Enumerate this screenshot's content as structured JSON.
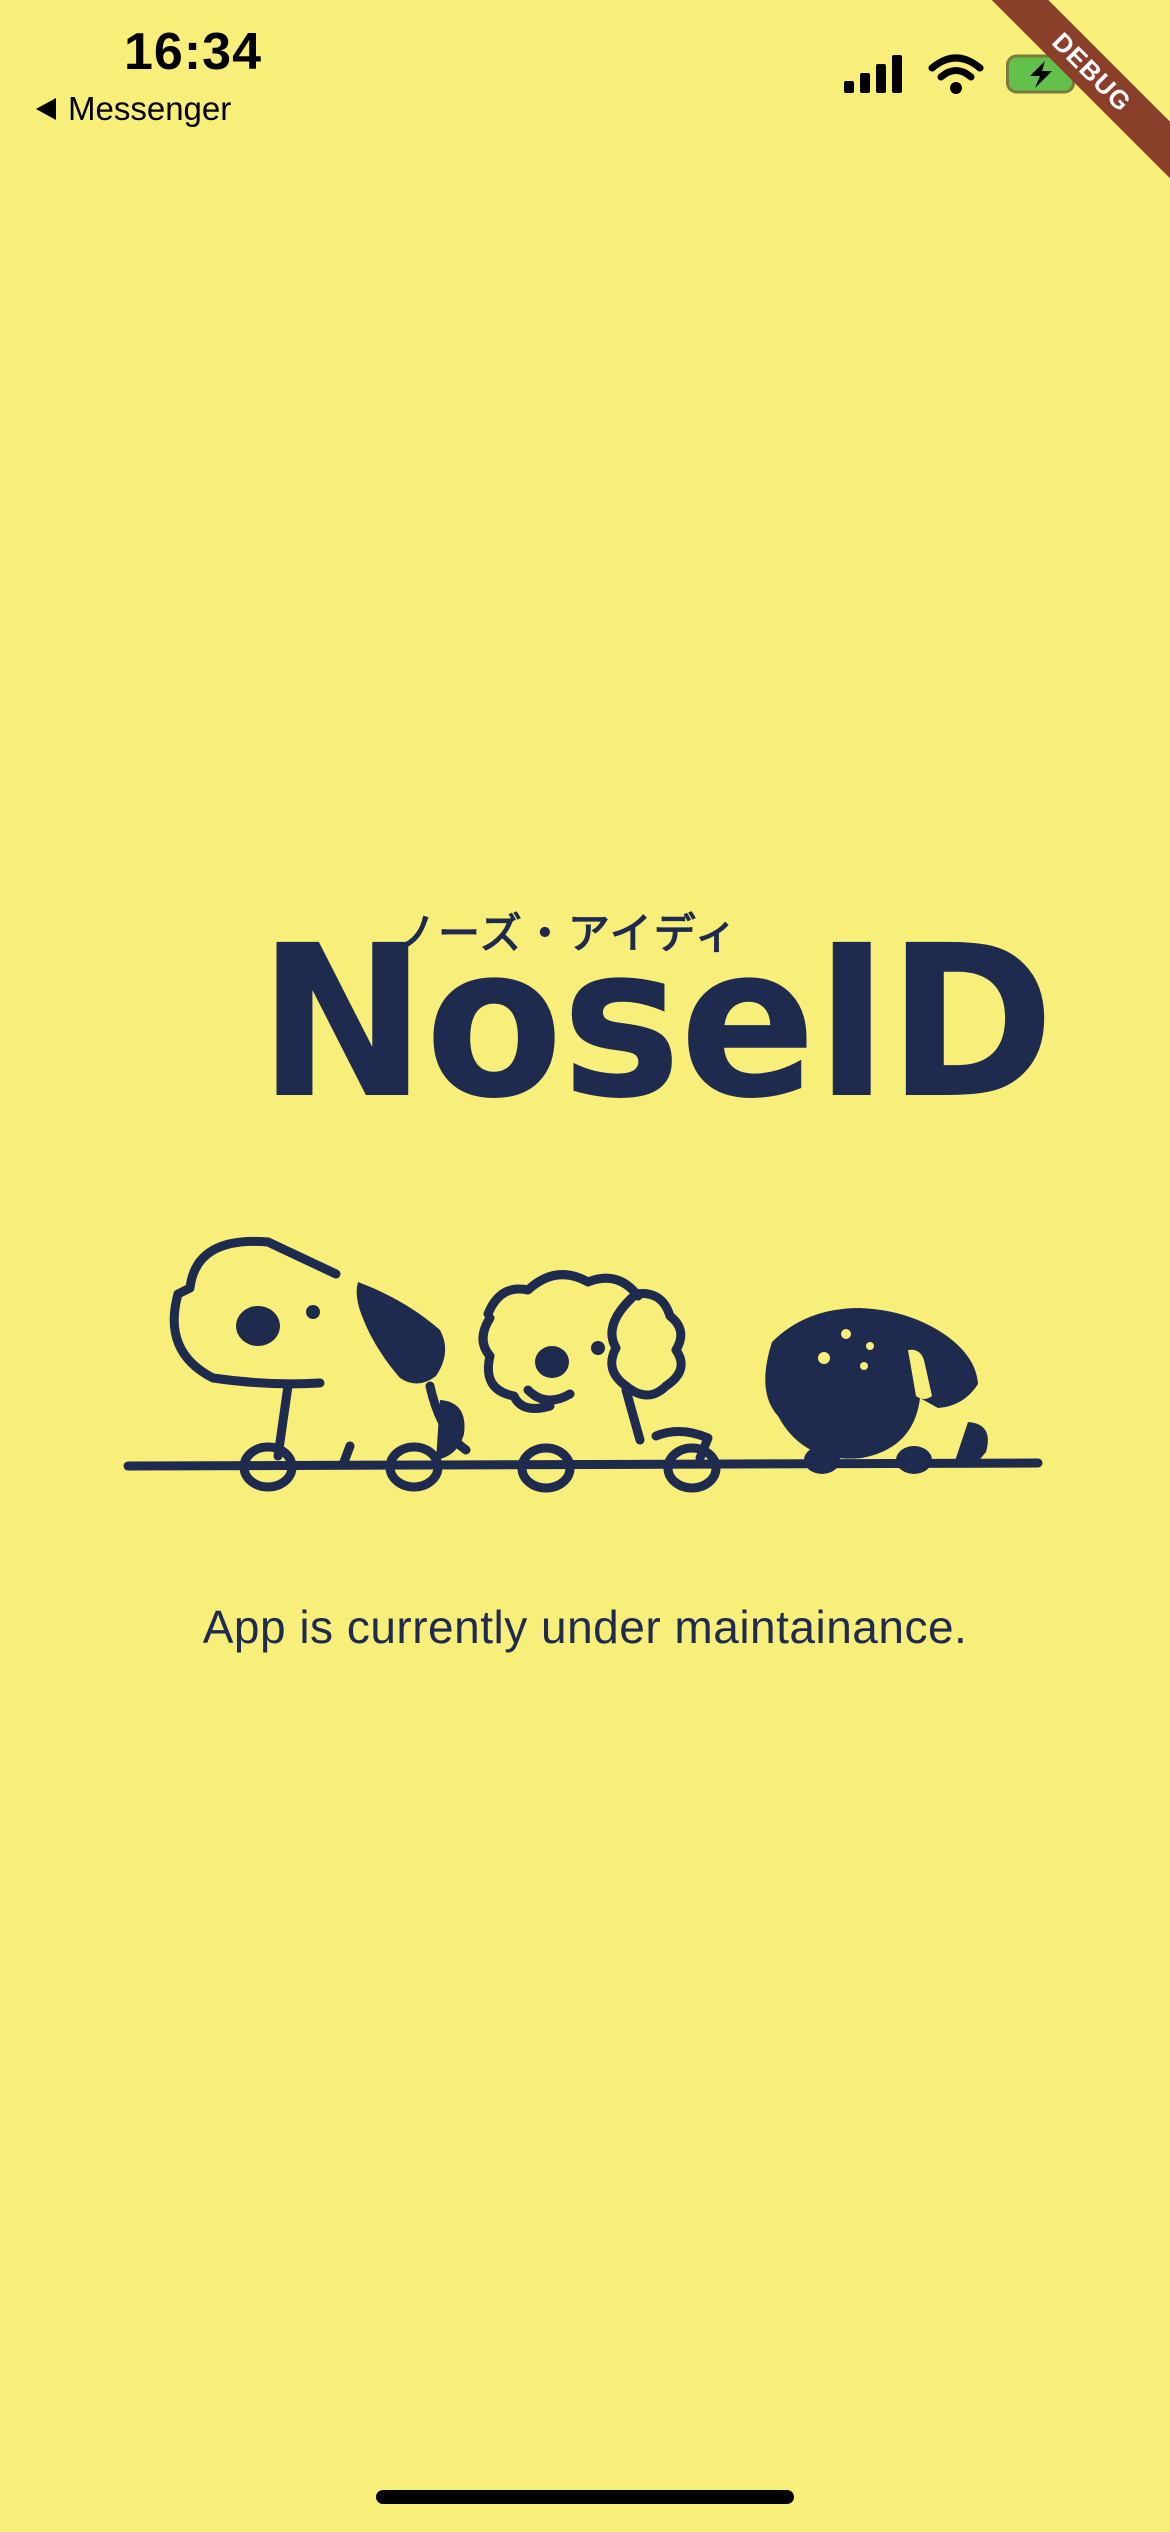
{
  "status_bar": {
    "time": "16:34",
    "back_label": "Messenger"
  },
  "debug_banner": "DEBUG",
  "logo": {
    "kana": "ノーズ・アイディ",
    "text": "NoseID"
  },
  "message": "App is currently under maintainance.",
  "colors": {
    "background": "#F8EE7A",
    "primary": "#1f2a4f",
    "debug": "#8a3f2a",
    "battery_fill": "#63c04a"
  },
  "icons": [
    "signal-icon",
    "wifi-icon",
    "battery-charging-icon",
    "back-arrow-icon"
  ]
}
